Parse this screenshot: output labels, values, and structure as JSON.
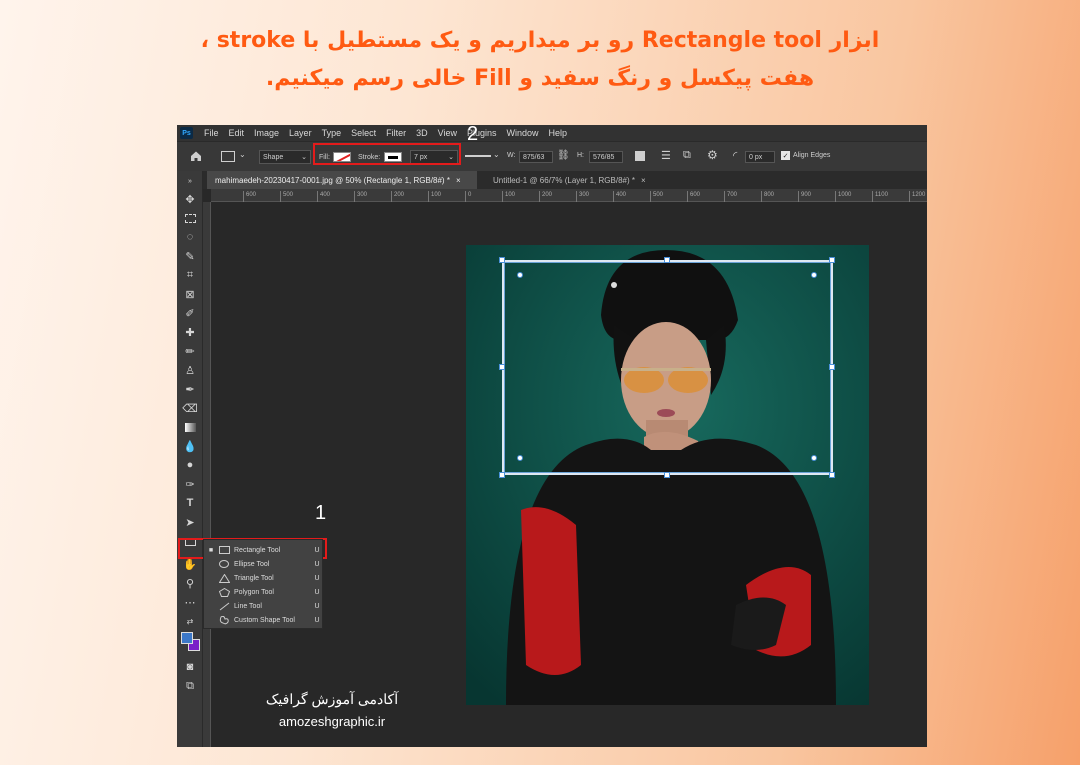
{
  "caption": {
    "line1": "ابزار Rectangle tool رو بر میداریم و یک مستطیل با stroke ،",
    "line2": "هفت پیکسل و رنگ سفید و Fill خالی رسم میکنیم."
  },
  "menubar": {
    "logo": "Ps",
    "items": [
      "File",
      "Edit",
      "Image",
      "Layer",
      "Type",
      "Select",
      "Filter",
      "3D",
      "View",
      "Plugins",
      "Window",
      "Help"
    ]
  },
  "options": {
    "mode": "Shape",
    "fill_label": "Fill:",
    "stroke_label": "Stroke:",
    "stroke_width": "7 px",
    "w_label": "W:",
    "w_value": "875/63",
    "h_label": "H:",
    "h_value": "576/85",
    "radius": "0 px",
    "align_edges": "Align Edges"
  },
  "annotations": {
    "one": "1",
    "two": "2"
  },
  "tabs": [
    {
      "label": "mahimaedeh-20230417-0001.jpg @ 50% (Rectangle 1, RGB/8#) *",
      "close": "×"
    },
    {
      "label": "Untitled-1 @ 66/7% (Layer 1, RGB/8#) *",
      "close": "×"
    }
  ],
  "ruler": [
    "600",
    "500",
    "400",
    "300",
    "200",
    "100",
    "0",
    "100",
    "200",
    "300",
    "400",
    "500",
    "600",
    "700",
    "800",
    "900",
    "1000",
    "1100",
    "1200"
  ],
  "flyout": [
    {
      "label": "Rectangle Tool",
      "key": "U",
      "icon": "rectangle-icon",
      "selected": true
    },
    {
      "label": "Ellipse Tool",
      "key": "U",
      "icon": "ellipse-icon",
      "selected": false
    },
    {
      "label": "Triangle Tool",
      "key": "U",
      "icon": "triangle-icon",
      "selected": false
    },
    {
      "label": "Polygon Tool",
      "key": "U",
      "icon": "polygon-icon",
      "selected": false
    },
    {
      "label": "Line Tool",
      "key": "U",
      "icon": "line-icon",
      "selected": false
    },
    {
      "label": "Custom Shape Tool",
      "key": "U",
      "icon": "custom-shape-icon",
      "selected": false
    }
  ],
  "watermark": {
    "title": "آکادمی آموزش گرافیک",
    "url": "amozeshgraphic.ir"
  },
  "colors": {
    "caption": "#ff5a12",
    "annotation": "#e31b1b",
    "canvas_bg": "#0e4a43",
    "foreground": "#3c78c8",
    "background": "#7a1fc8"
  }
}
